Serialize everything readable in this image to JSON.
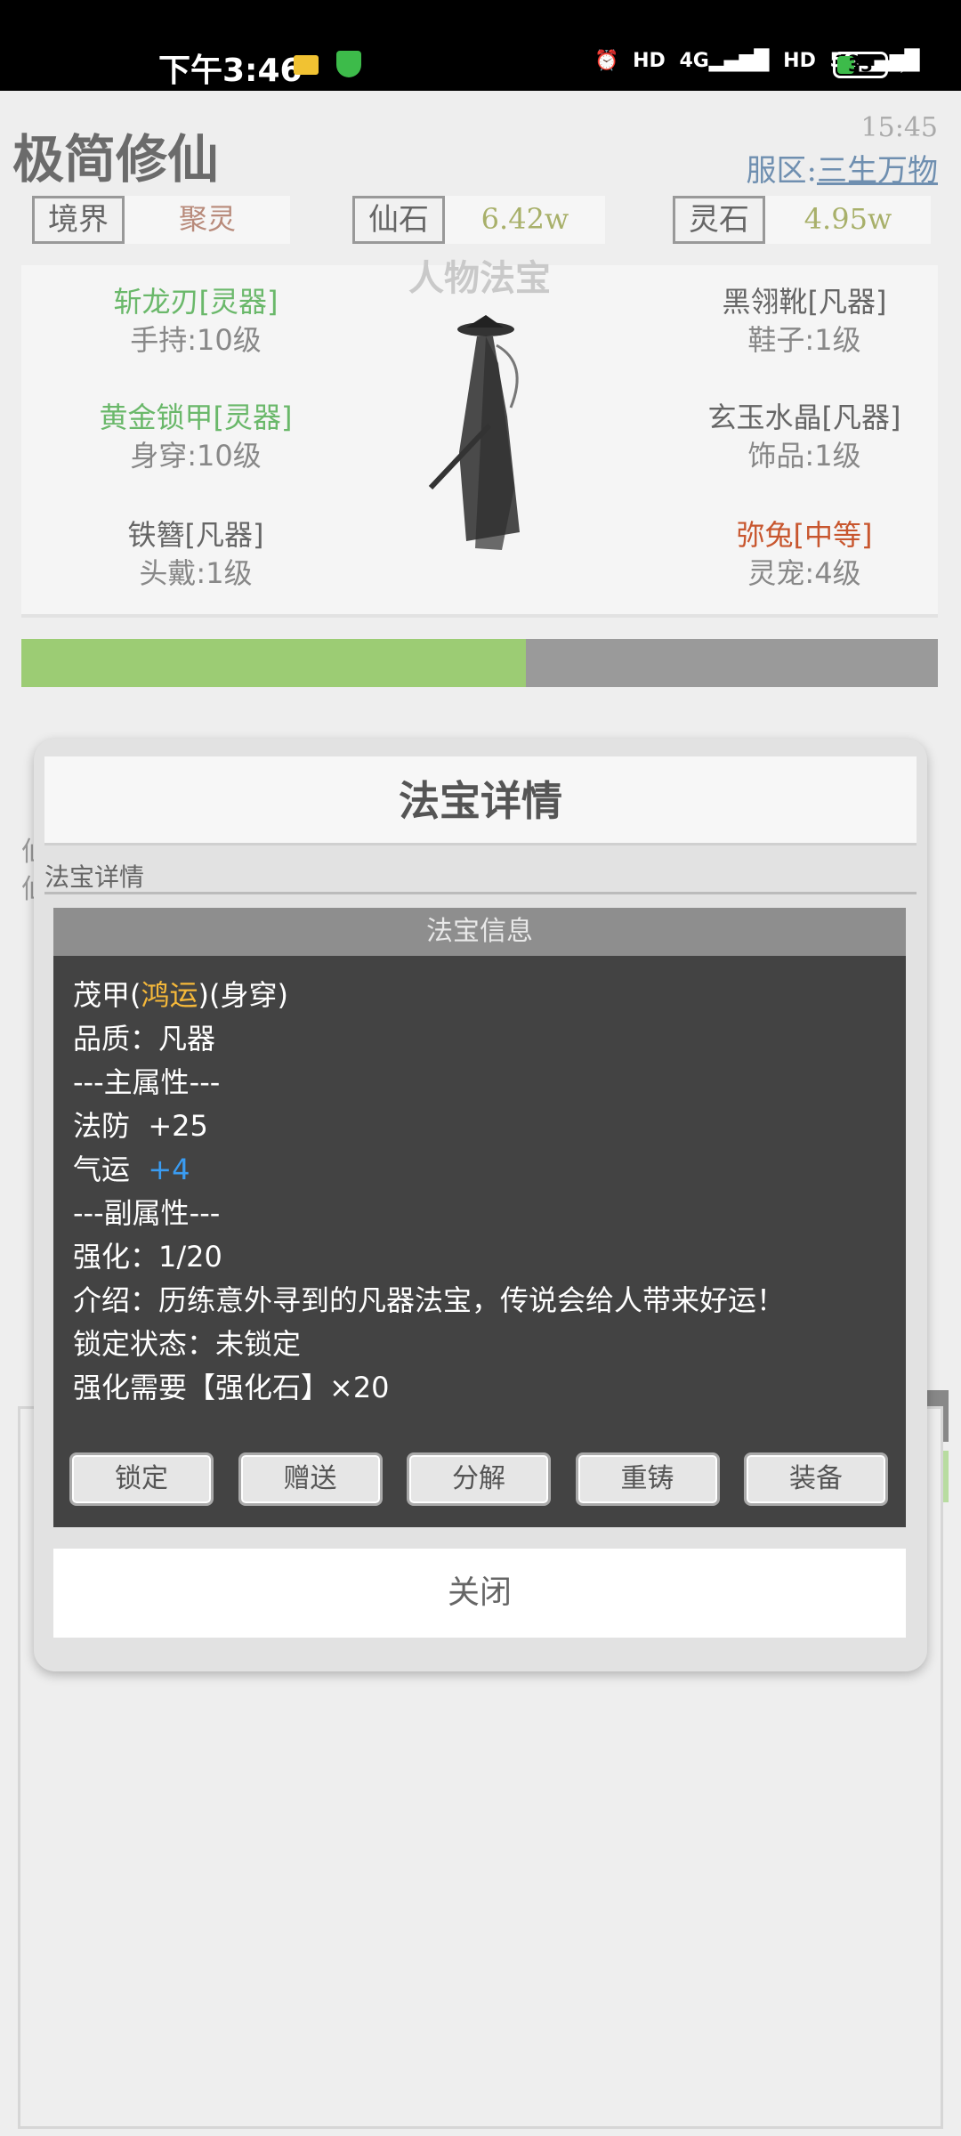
{
  "status_bar": {
    "time": "下午3:46",
    "icons": [
      "alarm-icon",
      "hd-icon",
      "4g-signal-icon",
      "hd-icon",
      "5g-signal-icon"
    ],
    "battery": "33"
  },
  "app": {
    "title": "极简修仙",
    "clock": "15:45",
    "server_label": "服区:",
    "server_name": "三生万物"
  },
  "stats": [
    {
      "label": "境界",
      "value": "聚灵",
      "color": "#b88a7a"
    },
    {
      "label": "仙石",
      "value": "6.42w",
      "color": "#a8b06a"
    },
    {
      "label": "灵石",
      "value": "4.95w",
      "color": "#a8b06a"
    }
  ],
  "equipment_panel": {
    "title": "人物法宝",
    "left": [
      {
        "name": "斩龙刃[灵器]",
        "slot": "手持:10级",
        "color": "#6ab86a"
      },
      {
        "name": "黄金锁甲[灵器]",
        "slot": "身穿:10级",
        "color": "#6ab86a"
      },
      {
        "name": "铁簪[凡器]",
        "slot": "头戴:1级",
        "color": "#666666"
      }
    ],
    "right": [
      {
        "name": "黑翎靴[凡器]",
        "slot": "鞋子:1级",
        "color": "#666666"
      },
      {
        "name": "玄玉水晶[凡器]",
        "slot": "饰品:1级",
        "color": "#666666"
      },
      {
        "name": "弥兔[中等]",
        "slot": "灵宠:4级",
        "color": "#c8562e"
      }
    ]
  },
  "progress": {
    "fraction": 0.55
  },
  "modal": {
    "title": "法宝详情",
    "subtitle": "法宝详情",
    "info_header": "法宝信息",
    "item": {
      "name_prefix": "茂甲(",
      "name_tag": "鸿运",
      "name_suffix": ")(身穿)",
      "quality": "品质：凡器",
      "main_attr_header": "---主属性---",
      "attr1_name": "法防",
      "attr1_value": "+25",
      "attr2_name": "气运",
      "attr2_value": "+4",
      "sub_attr_header": "---副属性---",
      "enhance": "强化：1/20",
      "description": "介绍：历练意外寻到的凡器法宝，传说会给人带来好运！",
      "lock_status": "锁定状态：未锁定",
      "enhance_need": "强化需要【强化石】×20"
    },
    "actions": [
      "锁定",
      "赠送",
      "分解",
      "重铸",
      "装备"
    ],
    "close_label": "关闭"
  }
}
